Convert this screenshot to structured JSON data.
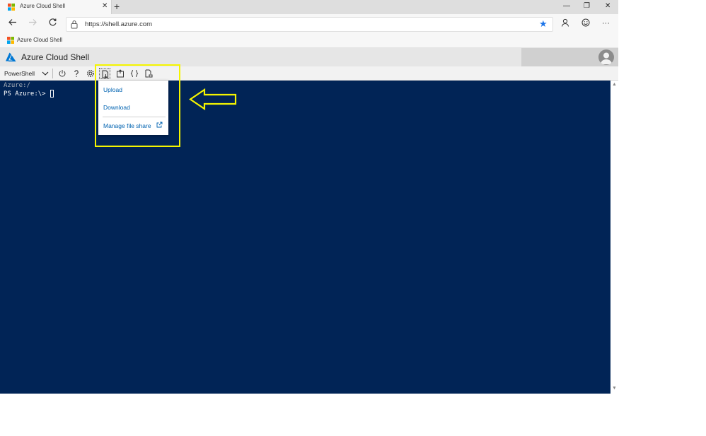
{
  "browser": {
    "tab_title": "Azure Cloud Shell",
    "tab_close": "✕",
    "new_tab": "+",
    "window_controls": {
      "minimize": "—",
      "restore": "❐",
      "close": "✕"
    },
    "url": "https://shell.azure.com",
    "favorites": [
      {
        "label": "Azure Cloud Shell"
      }
    ],
    "accent": "#1a73e8"
  },
  "portal": {
    "brand": "Azure Cloud Shell",
    "brand_color": "#0078d4"
  },
  "toolbar": {
    "shell_type": "PowerShell",
    "buttons": [
      "restart",
      "help",
      "settings",
      "upload-download",
      "open-new-session",
      "editor",
      "web-preview"
    ]
  },
  "terminal": {
    "line1": "Azure:/",
    "line2": "PS Azure:\\>",
    "background": "#012456"
  },
  "menu": {
    "items": [
      {
        "label": "Upload"
      },
      {
        "label": "Download"
      },
      {
        "label": "Manage file share"
      }
    ],
    "link_color": "#0063b1"
  },
  "annotation": {
    "highlight_color": "#f5f500"
  }
}
